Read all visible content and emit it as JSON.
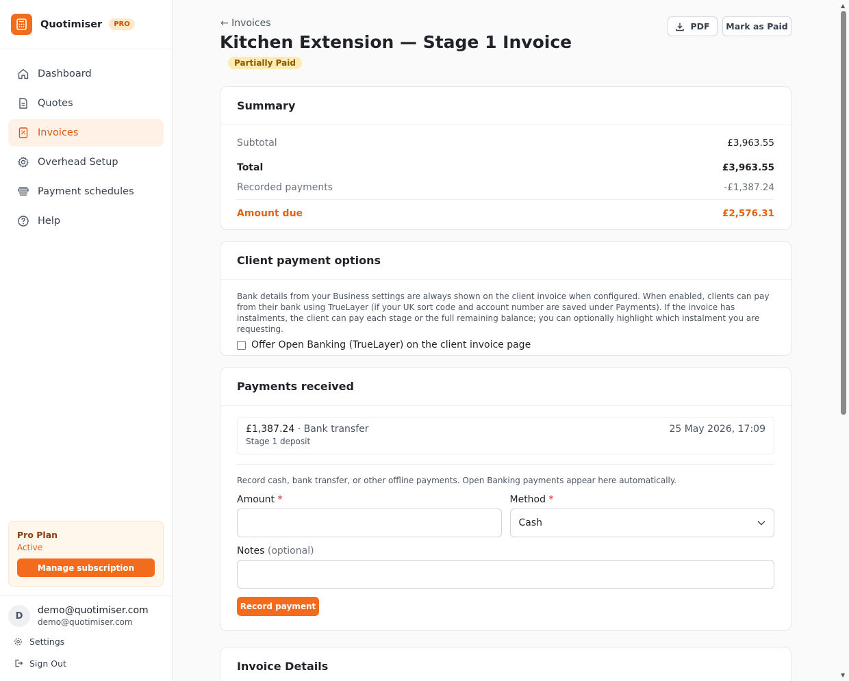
{
  "brand": {
    "name": "Quotimiser",
    "badge": "PRO"
  },
  "nav": [
    {
      "label": "Dashboard",
      "icon": "home-icon"
    },
    {
      "label": "Quotes",
      "icon": "document-icon"
    },
    {
      "label": "Invoices",
      "icon": "receipt-icon",
      "active": true
    },
    {
      "label": "Overhead Setup",
      "icon": "gear-icon"
    },
    {
      "label": "Payment schedules",
      "icon": "stack-icon"
    },
    {
      "label": "Help",
      "icon": "help-icon"
    }
  ],
  "plan": {
    "title": "Pro Plan",
    "status": "Active",
    "button": "Manage subscription"
  },
  "user": {
    "initial": "D",
    "name": "demo@quotimiser.com",
    "email": "demo@quotimiser.com"
  },
  "side_links": {
    "settings": "Settings",
    "sign_out": "Sign Out"
  },
  "header": {
    "back": "← Invoices",
    "title": "Kitchen Extension — Stage 1 Invoice",
    "status": "Partially Paid",
    "pdf": "PDF",
    "mark_paid": "Mark as Paid"
  },
  "summary": {
    "title": "Summary",
    "subtotal_label": "Subtotal",
    "subtotal": "£3,963.55",
    "total_label": "Total",
    "total": "£3,963.55",
    "payments_label": "Recorded payments",
    "payments": "-£1,387.24",
    "due_label": "Amount due",
    "due": "£2,576.31"
  },
  "client_options": {
    "title": "Client payment options",
    "description": "Bank details from your Business settings are always shown on the client invoice when configured. When enabled, clients can pay from their bank using TrueLayer (if your UK sort code and account number are saved under Payments). If the invoice has instalments, the client can pay each stage or the full remaining balance; you can optionally highlight which instalment you are requesting.",
    "checkbox_label": "Offer Open Banking (TrueLayer) on the client invoice page",
    "checked": false
  },
  "payments": {
    "title": "Payments received",
    "items": [
      {
        "amount": "£1,387.24",
        "method": " · Bank transfer",
        "note": "Stage 1 deposit",
        "date": "25 May 2026, 17:09"
      }
    ],
    "help": "Record cash, bank transfer, or other offline payments. Open Banking payments appear here automatically.",
    "amount_label": "Amount",
    "method_label": "Method",
    "method_value": "Cash",
    "notes_label": "Notes",
    "notes_optional": "(optional)",
    "record_button": "Record payment",
    "required_mark": "*"
  },
  "details": {
    "title": "Invoice Details"
  },
  "colors": {
    "accent": "#f36b1c",
    "accent_text": "#e06414",
    "badge_bg": "#fdebb3"
  }
}
